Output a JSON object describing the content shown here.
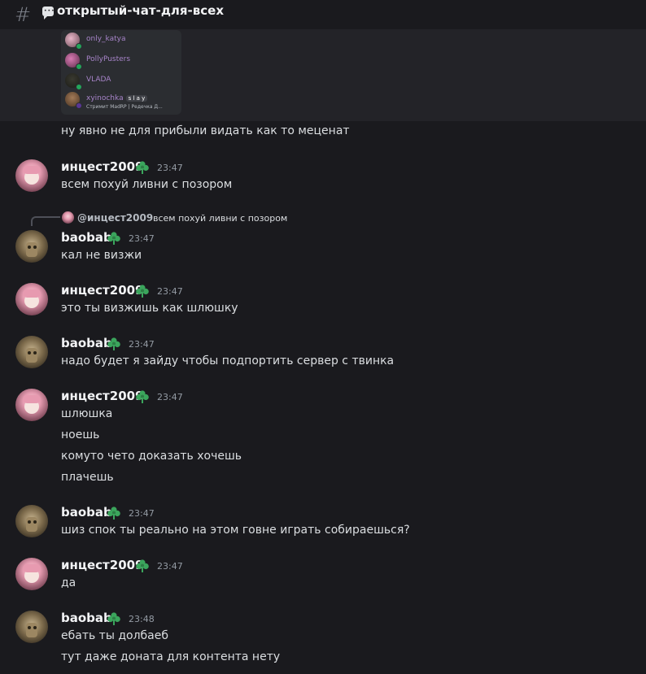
{
  "channel": {
    "name": "открытый-чат-для-всех",
    "hash_icon": "hash-icon",
    "type_icon": "speech-bubble-icon"
  },
  "embed_members": [
    {
      "name": "only_katya",
      "color": "#a784c9"
    },
    {
      "name": "PollyPusters",
      "color": "#a784c9"
    },
    {
      "name": "VLADA",
      "color": "#a784c9"
    },
    {
      "name": "xyinochka",
      "color": "#a784c9",
      "tag": "s l a y",
      "status": "Стримит MadRP | Редечка Д..."
    }
  ],
  "pre_message": "ну явно не для прибыли видать как то меценат",
  "messages": [
    {
      "author": "инцест2009",
      "time": "23:47",
      "lines": [
        "всем похуй ливни с позором"
      ]
    },
    {
      "author": "baobab",
      "time": "23:47",
      "reply": {
        "author": "@инцест2009",
        "text": "всем похуй ливни с позором"
      },
      "lines": [
        "кал не визжи"
      ]
    },
    {
      "author": "инцест2009",
      "time": "23:47",
      "lines": [
        "это ты визжишь как шлюшку"
      ]
    },
    {
      "author": "baobab",
      "time": "23:47",
      "lines": [
        "надо будет я зайду чтобы подпортить сервер с твинка"
      ]
    },
    {
      "author": "инцест2009",
      "time": "23:47",
      "lines": [
        "шлюшка",
        "ноешь",
        "комуто чето доказать хочешь",
        "плачешь"
      ]
    },
    {
      "author": "baobab",
      "time": "23:47",
      "lines": [
        "шиз спок ты реально на этом говне играть собираешься?"
      ]
    },
    {
      "author": "инцест2009",
      "time": "23:47",
      "lines": [
        "да"
      ]
    },
    {
      "author": "baobab",
      "time": "23:48",
      "lines": [
        "ебать ты долбаеб",
        "тут даже доната для контента нету"
      ]
    }
  ],
  "colors": {
    "bg": "#1a1a1e",
    "badge": "#3ba55c",
    "username": "#f2f3f5",
    "text": "#dbdee1",
    "time": "#949ba4"
  }
}
